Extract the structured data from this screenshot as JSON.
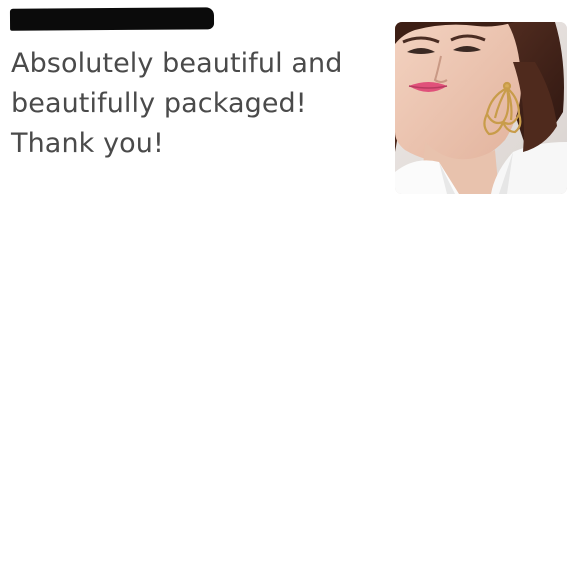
{
  "review": {
    "text": "Absolutely beautiful and beautifully packaged! Thank you!"
  },
  "photo": {
    "icon": "earring-model-photo"
  }
}
